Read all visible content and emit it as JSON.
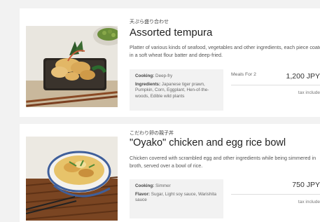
{
  "items": [
    {
      "jp_name": "天ぷら盛り合わせ",
      "title": "Assorted tempura",
      "description": "Platter of various kinds of seafood, vegetables and other ingredients, each piece coated in a soft wheat flour batter and deep-fried.",
      "cooking_label": "Cooking:",
      "cooking_value": "Deep-fry",
      "second_label": "Ingredients:",
      "second_value": "Japanese tiger prawn, Pumpkin, Corn, Eggplant, Hen-of-the-woods, Edible wild plants",
      "meals_label": "Meals For 2",
      "price": "1,200 JPY",
      "tax": "tax include"
    },
    {
      "jp_name": "こだわり卵の親子丼",
      "title": "\"Oyako\" chicken and egg rice bowl",
      "description": "Chicken covered with scrambled egg and other ingredients while being simmered in broth, served over a bowl of rice.",
      "cooking_label": "Cooking:",
      "cooking_value": "Simmer",
      "second_label": "Flavor:",
      "second_value": "Sugar, Light soy sauce, Warishita sauce",
      "price": "750 JPY",
      "tax": "tax include"
    }
  ]
}
